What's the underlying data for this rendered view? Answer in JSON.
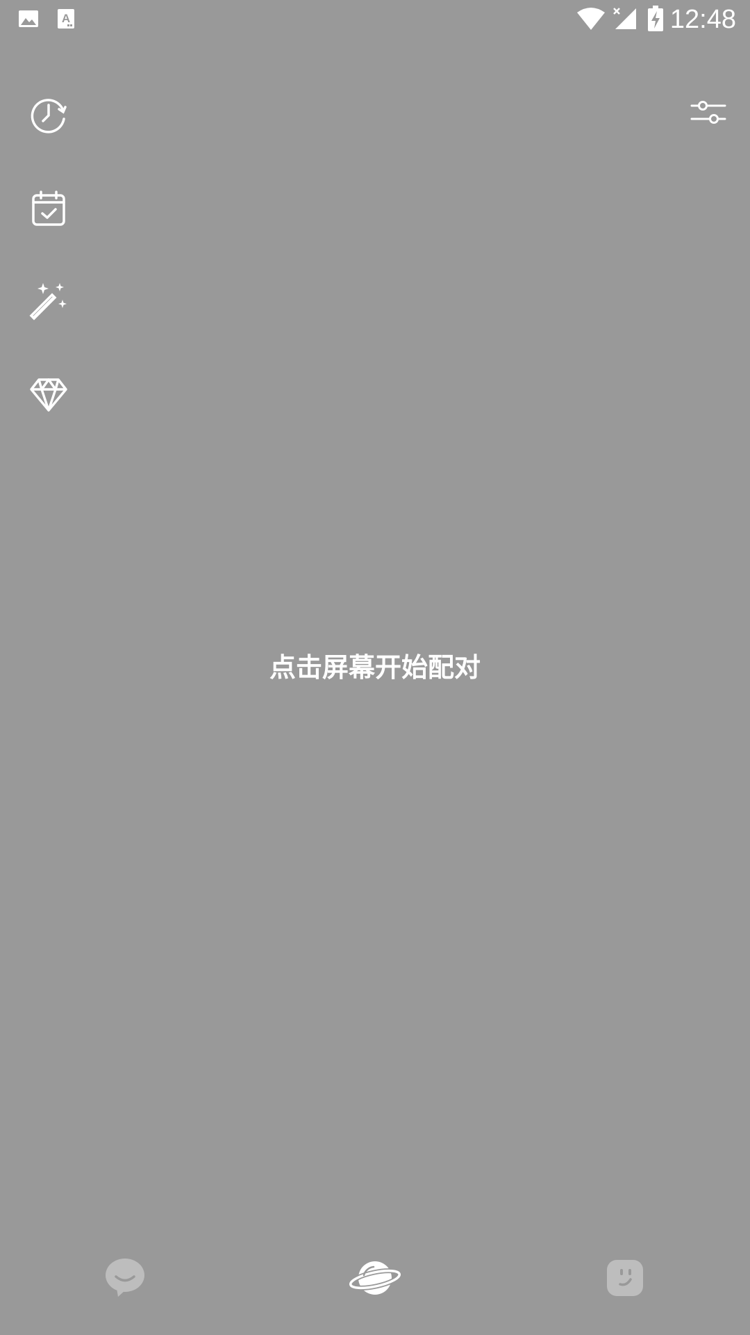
{
  "status_bar": {
    "time": "12:48",
    "left_icons": [
      "image-icon",
      "text-a-icon"
    ],
    "right_icons": [
      "wifi-icon",
      "signal-off-icon",
      "battery-charging-icon"
    ]
  },
  "left_rail": {
    "items": [
      {
        "icon": "history-clock-icon"
      },
      {
        "icon": "calendar-check-icon"
      },
      {
        "icon": "magic-wand-icon"
      },
      {
        "icon": "diamond-icon"
      }
    ]
  },
  "top_right": {
    "icon": "filter-sliders-icon"
  },
  "main": {
    "hint": "点击屏幕开始配对"
  },
  "bottom_nav": {
    "items": [
      {
        "icon": "chat-bubble-icon",
        "active": false
      },
      {
        "icon": "planet-icon",
        "active": true
      },
      {
        "icon": "face-icon",
        "active": false
      }
    ]
  },
  "colors": {
    "background": "#999999",
    "foreground": "#ffffff",
    "inactive": "#bdbdbd"
  }
}
